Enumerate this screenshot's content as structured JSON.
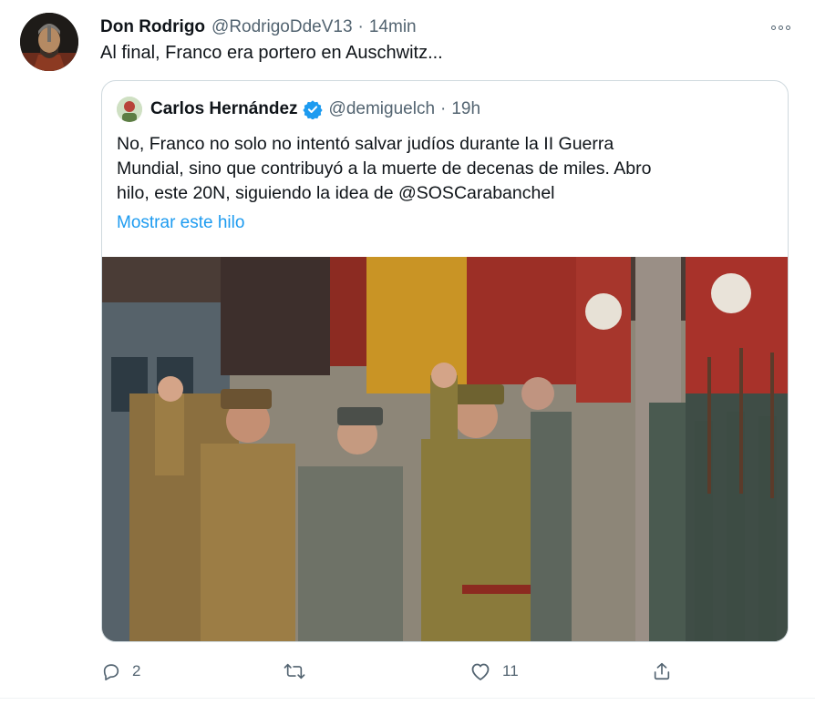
{
  "tweet": {
    "author": {
      "name": "Don Rodrigo",
      "handle": "@RodrigoDdeV13",
      "separator": "·",
      "time": "14min"
    },
    "text": "Al final, Franco era portero en Auschwitz...",
    "actions": {
      "reply_count": "2",
      "retweet_count": "",
      "like_count": "11"
    }
  },
  "quoted": {
    "author": {
      "name": "Carlos Hernández",
      "handle": "@demiguelch",
      "separator": "·",
      "time": "19h",
      "verified": true
    },
    "text_lines": [
      "No, Franco no solo no intentó salvar judíos durante la II Guerra",
      "Mundial, sino que contribuyó a la muerte de decenas de miles. Abro",
      "hilo, este 20N, siguiendo la idea de @SOSCarabanchel"
    ],
    "show_thread": "Mostrar este hilo"
  },
  "colors": {
    "link": "#1d9bf0",
    "secondary_text": "#536471",
    "border": "#cfd9de",
    "verified": "#1d9bf0"
  },
  "icons": [
    "more-icon",
    "verified-icon",
    "reply-icon",
    "retweet-icon",
    "like-icon",
    "share-icon"
  ]
}
